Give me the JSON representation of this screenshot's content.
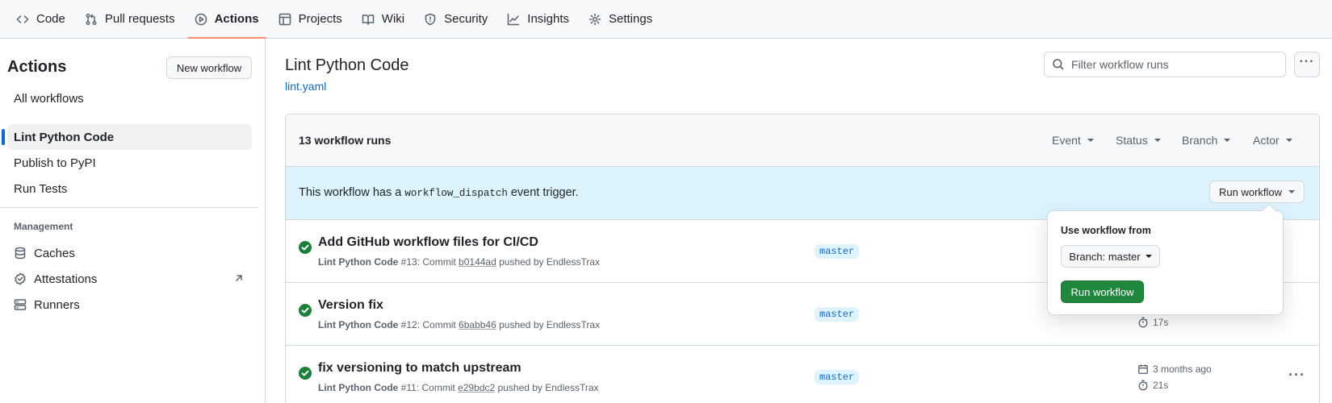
{
  "repo_nav": {
    "tabs": [
      {
        "label": "Code",
        "icon": "code-icon"
      },
      {
        "label": "Pull requests",
        "icon": "git-pull-request-icon"
      },
      {
        "label": "Actions",
        "icon": "play-icon"
      },
      {
        "label": "Projects",
        "icon": "table-icon"
      },
      {
        "label": "Wiki",
        "icon": "book-icon"
      },
      {
        "label": "Security",
        "icon": "shield-icon"
      },
      {
        "label": "Insights",
        "icon": "graph-icon"
      },
      {
        "label": "Settings",
        "icon": "gear-icon"
      }
    ],
    "selected": "Actions",
    "accent_color": "#fd8c73"
  },
  "sidebar": {
    "title": "Actions",
    "new_workflow_label": "New workflow",
    "items": [
      {
        "label": "All workflows"
      },
      {
        "label": "Lint Python Code"
      },
      {
        "label": "Publish to PyPI"
      },
      {
        "label": "Run Tests"
      }
    ],
    "selected": "Lint Python Code",
    "management_heading": "Management",
    "management_items": [
      {
        "label": "Caches",
        "icon": "database-icon"
      },
      {
        "label": "Attestations",
        "icon": "verified-icon"
      },
      {
        "label": "Runners",
        "icon": "server-icon"
      }
    ]
  },
  "main": {
    "title": "Lint Python Code",
    "file_link": "lint.yaml",
    "filter_placeholder": "Filter workflow runs"
  },
  "runs": {
    "count_label": "13 workflow runs",
    "filters": [
      "Event",
      "Status",
      "Branch",
      "Actor"
    ],
    "dispatch_prefix": "This workflow has a",
    "dispatch_code": "workflow_dispatch",
    "dispatch_suffix": "event trigger.",
    "run_workflow_label": "Run workflow",
    "rows": [
      {
        "title": "Add GitHub workflow files for CI/CD",
        "workflow": "Lint Python Code",
        "number": "#13",
        "commit_prefix": ": Commit",
        "sha": "b0144ad",
        "pushed_by": "pushed by EndlessTrax",
        "branch": "master",
        "status": "success"
      },
      {
        "title": "Version fix",
        "workflow": "Lint Python Code",
        "number": "#12",
        "commit_prefix": ": Commit",
        "sha": "6babb46",
        "pushed_by": "pushed by EndlessTrax",
        "branch": "master",
        "duration": "17s",
        "status": "success"
      },
      {
        "title": "fix versioning to match upstream",
        "workflow": "Lint Python Code",
        "number": "#11",
        "commit_prefix": ": Commit",
        "sha": "e29bdc2",
        "pushed_by": "pushed by EndlessTrax",
        "branch": "master",
        "date": "3 months ago",
        "duration": "21s",
        "status": "success"
      }
    ]
  },
  "popover": {
    "label": "Use workflow from",
    "branch_select": "Branch: master",
    "submit_label": "Run workflow",
    "submit_color": "#1f883d"
  }
}
